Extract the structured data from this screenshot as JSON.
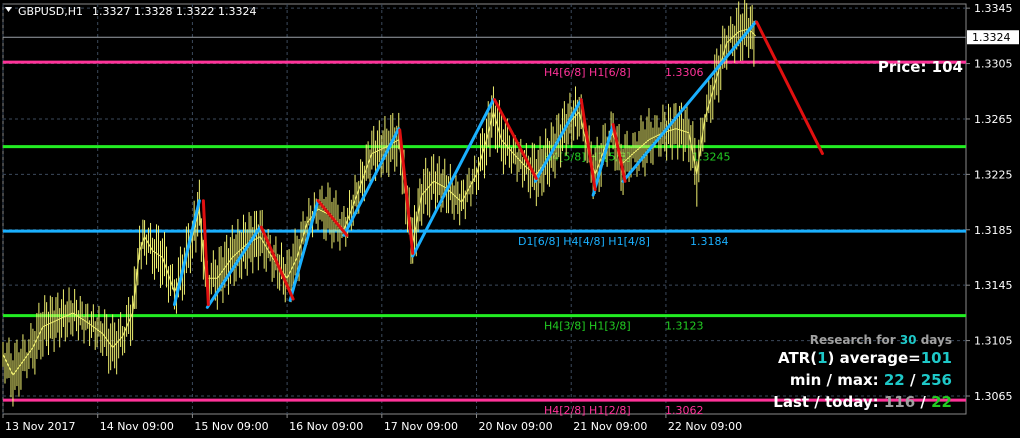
{
  "chart_data": {
    "type": "line",
    "title": "GBPUSD,H1",
    "ohlc": "1.3327 1.3328 1.3322 1.3324",
    "current_price_label": "1.3324",
    "current_price": 1.3324,
    "ylim": [
      1.3052,
      1.3348
    ],
    "y_ticks": [
      1.3345,
      1.3305,
      1.3265,
      1.3225,
      1.3185,
      1.3145,
      1.3105,
      1.3065
    ],
    "y_tick_labels": [
      "1.3345",
      "1.3305",
      "1.3265",
      "1.3225",
      "1.3185",
      "1.3145",
      "1.3105",
      "1.3065"
    ],
    "x_tick_labels": [
      "13 Nov 2017",
      "14 Nov 09:00",
      "15 Nov 09:00",
      "16 Nov 09:00",
      "17 Nov 09:00",
      "20 Nov 09:00",
      "21 Nov 09:00",
      "22 Nov 09:00"
    ],
    "x_ticks": [
      0,
      95,
      190,
      285,
      380,
      475,
      570,
      665
    ],
    "xlim": [
      0,
      960
    ],
    "grid": true,
    "levels": [
      {
        "name": "H4[6/8] H1[6/8]",
        "value": 1.3306,
        "value_label": "1.3306",
        "color": "#ff3399",
        "label_color": "#ff3399"
      },
      {
        "name": "H4[5/8] H1[5/8]",
        "value": 1.3245,
        "value_label": "1.3245",
        "color": "#22ee22",
        "label_color": "#22cc22"
      },
      {
        "name": "D1[6/8] H4[4/8] H1[4/8]",
        "value": 1.3184,
        "value_label": "1.3184",
        "color": "#1ab0ff",
        "label_color": "#1ab0ff"
      },
      {
        "name": "H4[3/8] H1[3/8]",
        "value": 1.3123,
        "value_label": "1.3123",
        "color": "#22ee22",
        "label_color": "#22cc22"
      },
      {
        "name": "H4[2/8] H1[2/8]",
        "value": 1.3062,
        "value_label": "1.3062",
        "color": "#ff3399",
        "label_color": "#ff3399"
      }
    ],
    "zigzag_up": [
      [
        [
          172,
          1.3131
        ],
        [
          197,
          1.3206
        ]
      ],
      [
        [
          205,
          1.3129
        ],
        [
          258,
          1.3187
        ]
      ],
      [
        [
          288,
          1.3134
        ],
        [
          316,
          1.3206
        ]
      ],
      [
        [
          342,
          1.3181
        ],
        [
          397,
          1.3258
        ]
      ],
      [
        [
          411,
          1.3166
        ],
        [
          492,
          1.3279
        ]
      ],
      [
        [
          534,
          1.322
        ],
        [
          580,
          1.3279
        ]
      ],
      [
        [
          592,
          1.321
        ],
        [
          612,
          1.3261
        ]
      ],
      [
        [
          622,
          1.322
        ],
        [
          755,
          1.3335
        ]
      ]
    ],
    "zigzag_down": [
      [
        [
          201,
          1.3206
        ],
        [
          206,
          1.3131
        ]
      ],
      [
        [
          259,
          1.3187
        ],
        [
          291,
          1.3135
        ]
      ],
      [
        [
          316,
          1.3206
        ],
        [
          345,
          1.3181
        ]
      ],
      [
        [
          398,
          1.3257
        ],
        [
          411,
          1.3168
        ]
      ],
      [
        [
          493,
          1.3279
        ],
        [
          535,
          1.3222
        ]
      ],
      [
        [
          580,
          1.3279
        ],
        [
          594,
          1.3214
        ]
      ],
      [
        [
          612,
          1.3261
        ],
        [
          624,
          1.322
        ]
      ],
      [
        [
          756,
          1.3335
        ],
        [
          822,
          1.324
        ]
      ]
    ],
    "zigzag_colors": {
      "up": "#1ab0ff",
      "down": "#e01010"
    },
    "price_series": [
      [
        0,
        1.3095
      ],
      [
        10,
        1.308
      ],
      [
        20,
        1.309
      ],
      [
        30,
        1.31
      ],
      [
        40,
        1.3115
      ],
      [
        55,
        1.312
      ],
      [
        70,
        1.3125
      ],
      [
        85,
        1.3118
      ],
      [
        100,
        1.311
      ],
      [
        110,
        1.31
      ],
      [
        120,
        1.3108
      ],
      [
        130,
        1.3125
      ],
      [
        137,
        1.317
      ],
      [
        142,
        1.318
      ],
      [
        150,
        1.317
      ],
      [
        160,
        1.3165
      ],
      [
        172,
        1.314
      ],
      [
        180,
        1.3155
      ],
      [
        190,
        1.318
      ],
      [
        197,
        1.32
      ],
      [
        203,
        1.315
      ],
      [
        215,
        1.315
      ],
      [
        230,
        1.3165
      ],
      [
        245,
        1.3175
      ],
      [
        258,
        1.318
      ],
      [
        270,
        1.3165
      ],
      [
        285,
        1.315
      ],
      [
        295,
        1.3165
      ],
      [
        305,
        1.319
      ],
      [
        316,
        1.32
      ],
      [
        330,
        1.3195
      ],
      [
        342,
        1.3185
      ],
      [
        355,
        1.321
      ],
      [
        370,
        1.324
      ],
      [
        385,
        1.3245
      ],
      [
        397,
        1.325
      ],
      [
        404,
        1.321
      ],
      [
        411,
        1.3175
      ],
      [
        420,
        1.321
      ],
      [
        432,
        1.322
      ],
      [
        445,
        1.3215
      ],
      [
        460,
        1.3205
      ],
      [
        475,
        1.3225
      ],
      [
        485,
        1.325
      ],
      [
        492,
        1.327
      ],
      [
        500,
        1.325
      ],
      [
        512,
        1.324
      ],
      [
        525,
        1.323
      ],
      [
        535,
        1.3225
      ],
      [
        550,
        1.324
      ],
      [
        565,
        1.326
      ],
      [
        578,
        1.327
      ],
      [
        586,
        1.3245
      ],
      [
        594,
        1.3225
      ],
      [
        604,
        1.3245
      ],
      [
        612,
        1.3255
      ],
      [
        620,
        1.3232
      ],
      [
        632,
        1.324
      ],
      [
        648,
        1.325
      ],
      [
        662,
        1.3255
      ],
      [
        675,
        1.3258
      ],
      [
        688,
        1.3255
      ],
      [
        696,
        1.3225
      ],
      [
        704,
        1.3265
      ],
      [
        716,
        1.3295
      ],
      [
        726,
        1.332
      ],
      [
        738,
        1.3328
      ],
      [
        748,
        1.333
      ],
      [
        755,
        1.3325
      ]
    ],
    "info_panel": {
      "research_prefix": "Research for ",
      "research_days": "30",
      "research_suffix": " days",
      "atr_prefix": "ATR(",
      "atr_period": "1",
      "atr_suffix": ") average=",
      "atr_value": "101",
      "minmax_prefix": "min / max: ",
      "min_value": "22",
      "minmax_sep": " / ",
      "max_value": "256",
      "last_prefix": "Last / today: ",
      "last_value": "116",
      "last_sep": " / ",
      "today_value": "22",
      "price_label": "Price: 104"
    },
    "colors": {
      "background": "#000000",
      "grid": "#3c4a5c",
      "candles": "#f0f070",
      "price_line": "#9aa0a8",
      "axis_text": "#ffffff",
      "info_grey": "#a0a0a0",
      "info_cyan": "#1ec8c8",
      "info_green": "#22cc22",
      "info_white": "#ffffff"
    }
  }
}
